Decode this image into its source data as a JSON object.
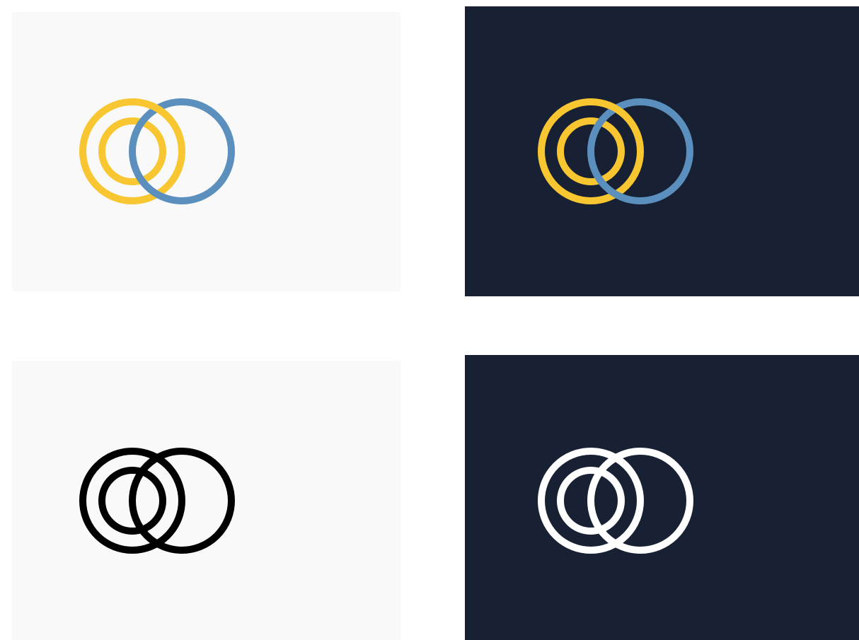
{
  "panels": [
    {
      "id": "color-on-light",
      "background": "#f9f9f9",
      "primary_ring_color": "#f8c630",
      "secondary_ring_color": "#5b8fbd"
    },
    {
      "id": "color-on-dark",
      "background": "#172133",
      "primary_ring_color": "#f8c630",
      "secondary_ring_color": "#5b8fbd"
    },
    {
      "id": "mono-black-on-light",
      "background": "#f9f9f9",
      "primary_ring_color": "#000000",
      "secondary_ring_color": "#000000"
    },
    {
      "id": "mono-white-on-dark",
      "background": "#172133",
      "primary_ring_color": "#ffffff",
      "secondary_ring_color": "#ffffff"
    }
  ]
}
